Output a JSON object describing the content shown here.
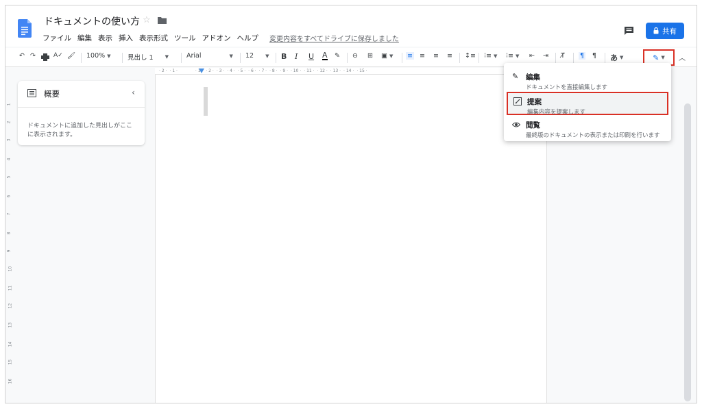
{
  "header": {
    "title": "ドキュメントの使い方",
    "menu": [
      "ファイル",
      "編集",
      "表示",
      "挿入",
      "表示形式",
      "ツール",
      "アドオン",
      "ヘルプ"
    ],
    "save_status": "変更内容をすべてドライブに保存しました",
    "share_label": "共有"
  },
  "toolbar": {
    "zoom": "100%",
    "style": "見出し 1",
    "font": "Arial",
    "size": "12",
    "input_mode": "あ"
  },
  "outline": {
    "title": "概要",
    "hint": "ドキュメントに追加した見出しがここに表示されます。"
  },
  "mode_menu": {
    "items": [
      {
        "title": "編集",
        "desc": "ドキュメントを直接編集します",
        "icon": "pencil-icon"
      },
      {
        "title": "提案",
        "desc": "編集内容を提案します",
        "icon": "suggest-icon"
      },
      {
        "title": "閲覧",
        "desc": "最終版のドキュメントの表示または印刷を行います",
        "icon": "eye-icon"
      }
    ]
  },
  "colors": {
    "accent": "#1a73e8",
    "highlight_box": "#d93025"
  }
}
